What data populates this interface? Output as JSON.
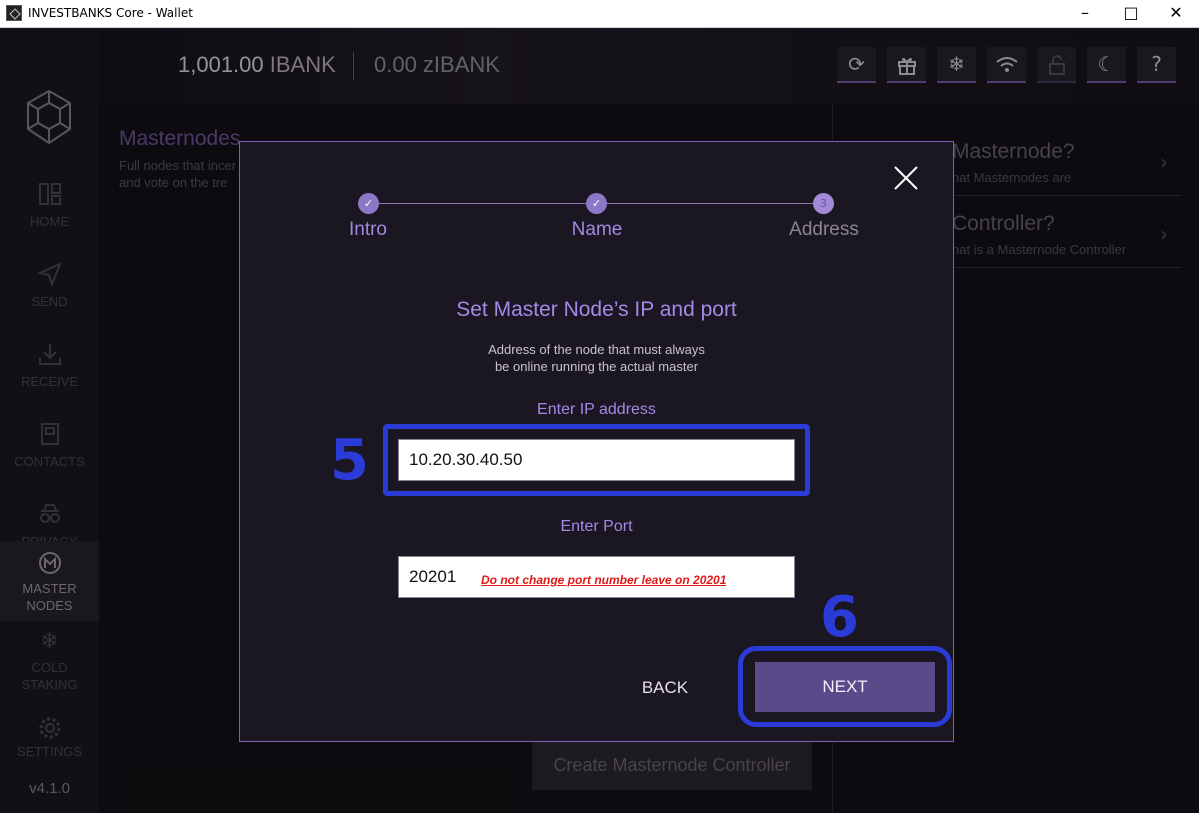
{
  "window": {
    "title": "INVESTBANKS Core - Wallet",
    "minimize": "–",
    "maximize": "□",
    "close": "✕"
  },
  "header": {
    "balance_amount": "1,001.00",
    "balance_unit": "IBANK",
    "zbalance": "0.00 zIBANK",
    "buttons": [
      {
        "icon": "refresh-icon",
        "glyph": "⟳"
      },
      {
        "icon": "gift-icon",
        "glyph": "🎁"
      },
      {
        "icon": "snowflake-icon",
        "glyph": "❄"
      },
      {
        "icon": "wifi-icon",
        "glyph": "◠"
      },
      {
        "icon": "unlock-icon",
        "glyph": "🔓"
      },
      {
        "icon": "moon-icon",
        "glyph": "☾"
      },
      {
        "icon": "help-icon",
        "glyph": "?"
      }
    ]
  },
  "sidebar": {
    "items": [
      {
        "label": "HOME",
        "icon": "home-icon"
      },
      {
        "label": "SEND",
        "icon": "send-icon"
      },
      {
        "label": "RECEIVE",
        "icon": "receive-icon"
      },
      {
        "label": "CONTACTS",
        "icon": "contacts-icon"
      },
      {
        "label": "PRIVACY",
        "icon": "privacy-icon"
      },
      {
        "label": "MASTER NODES",
        "icon": "masternodes-icon"
      },
      {
        "label": "COLD STAKING",
        "icon": "snowflake-icon"
      },
      {
        "label": "SETTINGS",
        "icon": "gear-icon"
      }
    ],
    "active": "MASTER NODES",
    "version": "v4.1.0"
  },
  "page": {
    "title": "Masternodes",
    "subtitle_line1": "Full nodes that incer",
    "subtitle_line2": "and vote on the tre",
    "create_button": "Create Masternode Controller"
  },
  "help": [
    {
      "title": "Masternode?",
      "subtitle": "hat Masternodes are"
    },
    {
      "title": "Controller?",
      "subtitle": "hat is a Masternode Controller"
    }
  ],
  "dialog": {
    "steps": [
      {
        "label": "Intro",
        "state": "done"
      },
      {
        "label": "Name",
        "state": "done"
      },
      {
        "label": "Address",
        "state": "current",
        "number": "3"
      }
    ],
    "title": "Set Master Node’s IP and port",
    "subtitle_line1": "Address of the node that must always",
    "subtitle_line2": "be online running the actual master",
    "ip_label": "Enter IP address",
    "ip_value": "10.20.30.40.50",
    "port_label": "Enter Port",
    "port_value": "20201",
    "port_warning": "Do not change port number leave on 20201",
    "back_label": "BACK",
    "next_label": "NEXT"
  },
  "annotations": {
    "step5": "5",
    "step6": "6",
    "color": "#2a3bd8"
  }
}
